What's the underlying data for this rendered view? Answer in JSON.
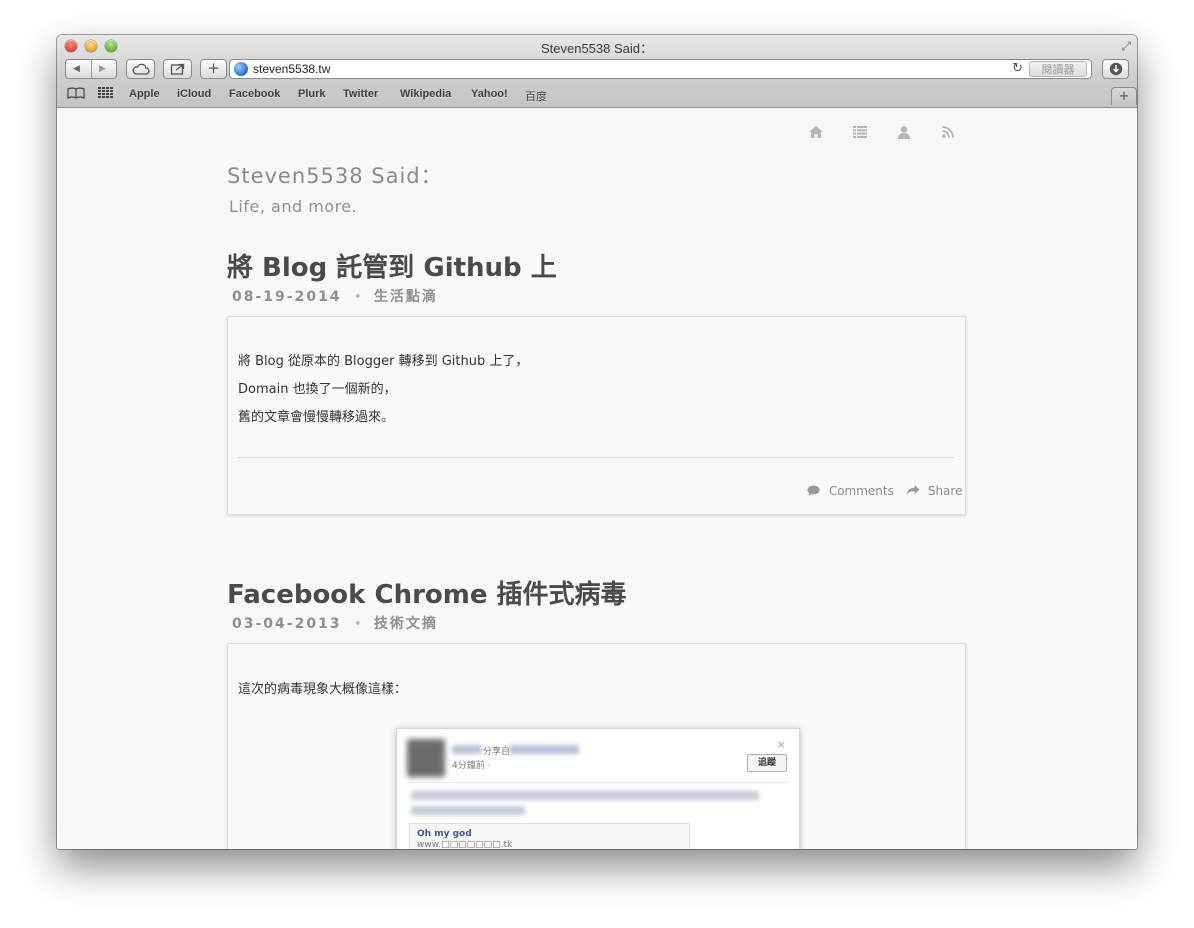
{
  "window": {
    "title": "Steven5538 Said："
  },
  "toolbar": {
    "url": "steven5538.tw",
    "reader_label": "閱讀器"
  },
  "bookmarks": {
    "items": [
      "Apple",
      "iCloud",
      "Facebook",
      "Plurk",
      "Twitter",
      "Wikipedia",
      "Yahoo!",
      "百度"
    ]
  },
  "icons": {
    "back": "back-arrow-icon",
    "forward": "forward-arrow-icon",
    "icloud": "cloud-icon",
    "share": "share-icon",
    "add": "plus-icon",
    "reload": "reload-icon",
    "downloads": "download-icon",
    "reading_list": "book-icon",
    "top_sites": "grid-icon",
    "nav": [
      "home-icon",
      "list-icon",
      "user-icon",
      "rss-icon"
    ]
  },
  "site": {
    "title": "Steven5538 Said：",
    "subtitle": "Life, and more."
  },
  "posts": [
    {
      "title": "將 Blog 託管到 Github 上",
      "date": "08-19-2014",
      "category": "生活點滴",
      "lines": [
        "將 Blog 從原本的 Blogger 轉移到 Github 上了，",
        "Domain 也換了一個新的，",
        "舊的文章會慢慢轉移過來。"
      ],
      "comments_label": "Comments",
      "share_label": "Share"
    },
    {
      "title": "Facebook Chrome 插件式病毒",
      "date": "03-04-2013",
      "category": "技術文摘",
      "lines": [
        "這次的病毒現象大概像這樣："
      ],
      "screenshot": {
        "shared_text": "分享自",
        "time": "4分鐘前 · ",
        "follow_label": "追蹤",
        "close": "×",
        "link_title": "Oh my god",
        "link_url": "www.□□□□□□□.tk"
      }
    }
  ],
  "colors": {
    "page_bg": "#f8f8f8",
    "title_text": "#4a4a4a",
    "meta_text": "#8f8f8f",
    "facebook_blue": "#3b5998"
  }
}
